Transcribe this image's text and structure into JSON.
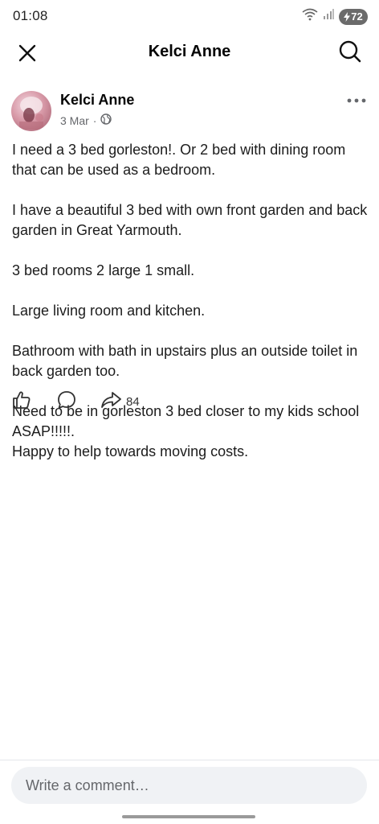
{
  "status": {
    "time": "01:08",
    "battery": "72",
    "icons": [
      "wifi-icon",
      "signal-icon",
      "battery-icon"
    ]
  },
  "header": {
    "title": "Kelci Anne",
    "close_icon": "close-icon",
    "search_icon": "search-icon"
  },
  "post": {
    "author": "Kelci Anne",
    "date": "3 Mar",
    "privacy_icon": "globe-icon",
    "paragraphs": [
      "I need a 3 bed gorleston!. Or 2 bed with dining room that can be used as a bedroom.",
      "I have a beautiful 3 bed with own front garden and back garden in Great Yarmouth.",
      "3 bed rooms 2 large 1 small.",
      "Large living room and kitchen.",
      "Bathroom with bath in upstairs plus an outside toilet in back garden too.",
      "Need to be in gorleston 3 bed  closer to my kids school ASAP!!!!!.",
      "Happy to help towards moving costs."
    ],
    "share_count": "84"
  },
  "comment": {
    "placeholder": "Write a comment…"
  },
  "colors": {
    "text": "#050505",
    "secondary": "#65676b",
    "input_bg": "#f0f2f5",
    "battery_bg": "#6b6b6b"
  }
}
